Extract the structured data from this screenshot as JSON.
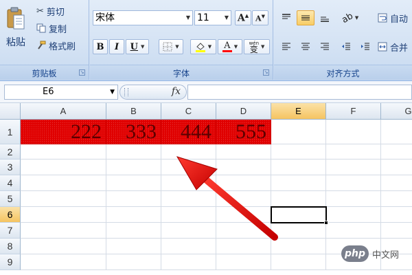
{
  "ribbon": {
    "clipboard": {
      "paste_label": "粘贴",
      "cut_label": "剪切",
      "copy_label": "复制",
      "format_painter_label": "格式刷",
      "group_label": "剪贴板"
    },
    "font": {
      "font_name": "宋体",
      "font_size": "11",
      "grow_label": "A",
      "shrink_label": "A",
      "bold_label": "B",
      "italic_label": "I",
      "underline_label": "U",
      "font_color_label": "A",
      "phonetic_label": "wén",
      "phonetic_char": "变",
      "group_label": "字体",
      "fill_color": "#ffff00",
      "font_color": "#ff0000"
    },
    "alignment": {
      "wrap_label": "自动",
      "merge_label": "合并",
      "group_label": "对齐方式"
    }
  },
  "formula_bar": {
    "name_box_value": "E6",
    "fx_label": "fx"
  },
  "sheet": {
    "columns": [
      "A",
      "B",
      "C",
      "D",
      "E",
      "F",
      "G"
    ],
    "rows": [
      "1",
      "2",
      "3",
      "4",
      "5",
      "6",
      "7",
      "8",
      "9"
    ],
    "selected_column": "E",
    "selected_row": "6",
    "active_cell": "E6",
    "row1_values": [
      "222",
      "333",
      "444",
      "555"
    ],
    "fill_color": "#e00000"
  },
  "watermark": {
    "badge": "php",
    "site": "中文网"
  },
  "annotation": {
    "arrow_color": "#e01010"
  }
}
